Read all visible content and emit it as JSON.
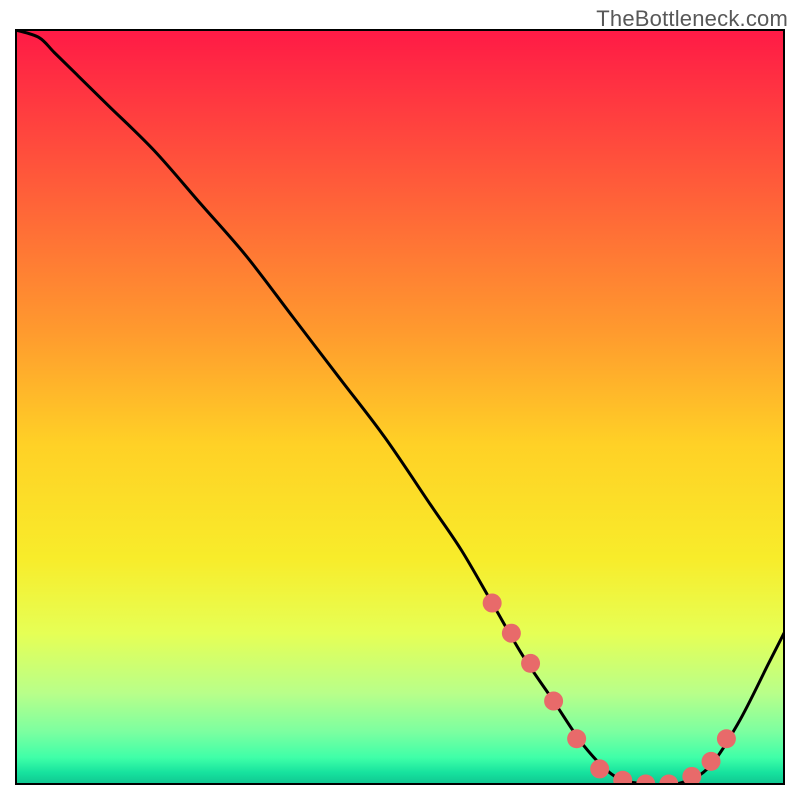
{
  "watermark": "TheBottleneck.com",
  "colors": {
    "gradient_stops": [
      {
        "offset": 0.0,
        "color": "#ff1a46"
      },
      {
        "offset": 0.2,
        "color": "#ff5a3a"
      },
      {
        "offset": 0.4,
        "color": "#ff9a2e"
      },
      {
        "offset": 0.55,
        "color": "#ffd126"
      },
      {
        "offset": 0.7,
        "color": "#f8ec2a"
      },
      {
        "offset": 0.8,
        "color": "#e6ff55"
      },
      {
        "offset": 0.88,
        "color": "#b8ff8a"
      },
      {
        "offset": 0.93,
        "color": "#7dffa0"
      },
      {
        "offset": 0.965,
        "color": "#3fffa8"
      },
      {
        "offset": 0.985,
        "color": "#16e29e"
      },
      {
        "offset": 1.0,
        "color": "#10c691"
      }
    ],
    "line": "#000000",
    "marker_fill": "#e86a6a",
    "marker_stroke": "#e86a6a",
    "border": "#000000"
  },
  "chart_data": {
    "type": "line",
    "title": "",
    "xlabel": "",
    "ylabel": "",
    "xlim": [
      0,
      100
    ],
    "ylim": [
      0,
      100
    ],
    "series": [
      {
        "name": "bottleneck-curve",
        "x": [
          0,
          3,
          5,
          8,
          12,
          18,
          24,
          30,
          36,
          42,
          48,
          54,
          58,
          62,
          66,
          70,
          74,
          78,
          82,
          86,
          90,
          94,
          98,
          100
        ],
        "y": [
          100,
          99,
          97,
          94,
          90,
          84,
          77,
          70,
          62,
          54,
          46,
          37,
          31,
          24,
          17,
          11,
          5,
          1,
          0,
          0,
          2,
          8,
          16,
          20
        ]
      }
    ],
    "markers": {
      "name": "highlighted-points",
      "x": [
        62,
        64.5,
        67,
        70,
        73,
        76,
        79,
        82,
        85,
        88,
        90.5,
        92.5
      ],
      "y": [
        24,
        20,
        16,
        11,
        6,
        2,
        0.5,
        0,
        0,
        1,
        3,
        6
      ]
    }
  }
}
